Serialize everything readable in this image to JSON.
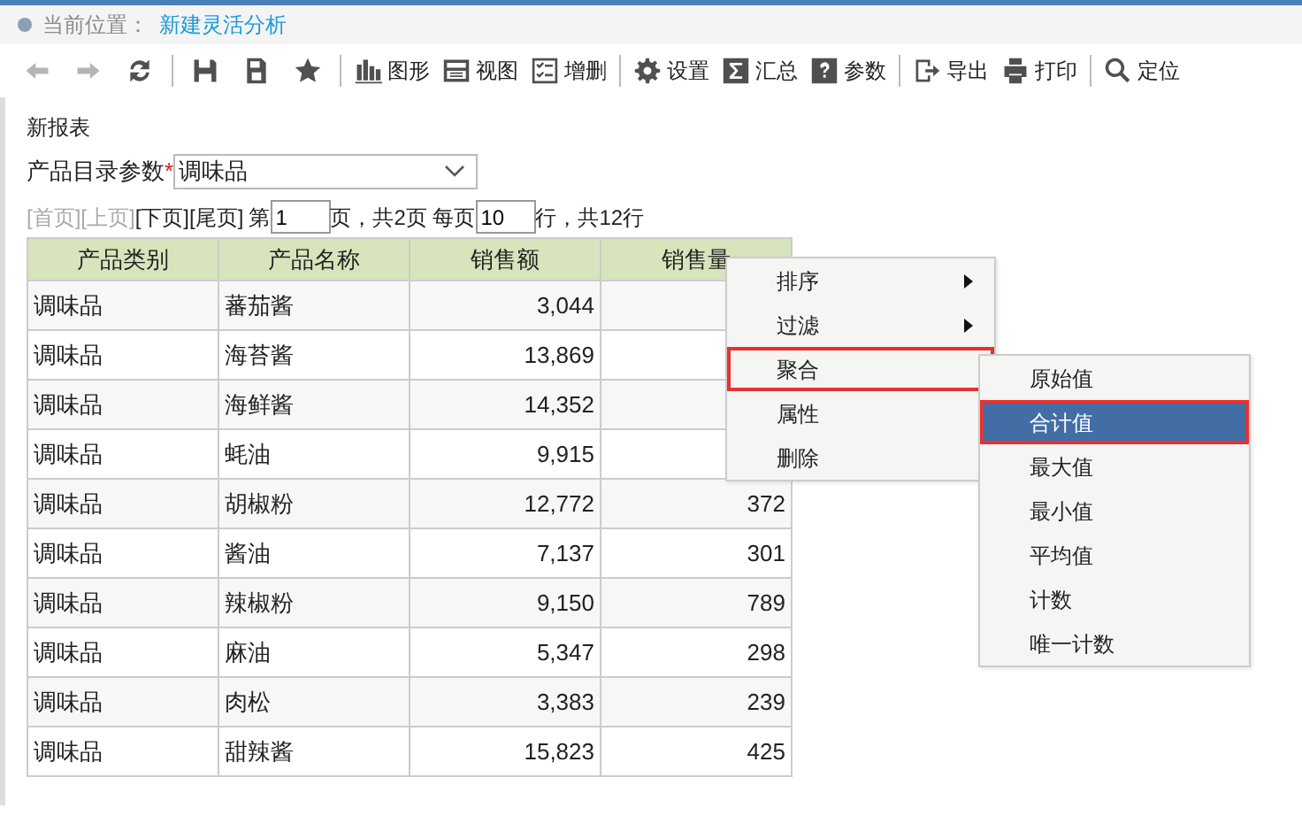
{
  "breadcrumb": {
    "label": "当前位置：",
    "current": "新建灵活分析"
  },
  "toolbar": [
    {
      "kind": "icon",
      "disabled": true
    },
    {
      "kind": "icon",
      "disabled": true
    },
    {
      "kind": "icon",
      "disabled": false
    },
    {
      "kind": "separator"
    },
    {
      "kind": "icon",
      "disabled": false
    },
    {
      "kind": "icon",
      "disabled": false
    },
    {
      "kind": "icon",
      "disabled": false
    },
    {
      "kind": "separator"
    },
    {
      "kind": "button",
      "label": "图形"
    },
    {
      "kind": "button",
      "label": "视图"
    },
    {
      "kind": "button",
      "label": "增删"
    },
    {
      "kind": "separator"
    },
    {
      "kind": "button",
      "label": "设置"
    },
    {
      "kind": "button",
      "label": "汇总"
    },
    {
      "kind": "button",
      "label": "参数"
    },
    {
      "kind": "separator"
    },
    {
      "kind": "button",
      "label": "导出"
    },
    {
      "kind": "button",
      "label": "打印"
    },
    {
      "kind": "separator"
    },
    {
      "kind": "button",
      "label": "定位"
    }
  ],
  "report_title": "新报表",
  "parameter": {
    "label": "产品目录参数",
    "required_mark": "*",
    "value": "调味品"
  },
  "pager": {
    "links": [
      {
        "label": "[首页]",
        "disabled": true
      },
      {
        "label": "[上页]",
        "disabled": true
      },
      {
        "label": "[下页]",
        "disabled": false
      },
      {
        "label": "[尾页]",
        "disabled": false
      }
    ],
    "page_prefix": "第",
    "page": "1",
    "page_suffix": "页，共2页 每页",
    "per_page": "10",
    "rows_suffix": "行，共12行"
  },
  "table": {
    "columns": [
      "产品类别",
      "产品名称",
      "销售额",
      "销售量"
    ],
    "rows": [
      [
        "调味品",
        "蕃茄酱",
        "3,044",
        null
      ],
      [
        "调味品",
        "海苔酱",
        "13,869",
        null
      ],
      [
        "调味品",
        "海鲜酱",
        "14,352",
        null
      ],
      [
        "调味品",
        "蚝油",
        "9,915",
        null
      ],
      [
        "调味品",
        "胡椒粉",
        "12,772",
        "372"
      ],
      [
        "调味品",
        "酱油",
        "7,137",
        "301"
      ],
      [
        "调味品",
        "辣椒粉",
        "9,150",
        "789"
      ],
      [
        "调味品",
        "麻油",
        "5,347",
        "298"
      ],
      [
        "调味品",
        "肉松",
        "3,383",
        "239"
      ],
      [
        "调味品",
        "甜辣酱",
        "15,823",
        "425"
      ]
    ]
  },
  "context_menu": [
    {
      "label": "排序",
      "submenu": true,
      "highlighted": false
    },
    {
      "label": "过滤",
      "submenu": true,
      "highlighted": false
    },
    {
      "label": "聚合",
      "submenu": false,
      "highlighted": true
    },
    {
      "label": "属性",
      "submenu": false,
      "highlighted": false
    },
    {
      "label": "删除",
      "submenu": false,
      "highlighted": false
    }
  ],
  "submenu": [
    {
      "label": "原始值",
      "selected": false,
      "highlighted": false
    },
    {
      "label": "合计值",
      "selected": true,
      "highlighted": true
    },
    {
      "label": "最大值",
      "selected": false,
      "highlighted": false
    },
    {
      "label": "最小值",
      "selected": false,
      "highlighted": false
    },
    {
      "label": "平均值",
      "selected": false,
      "highlighted": false
    },
    {
      "label": "计数",
      "selected": false,
      "highlighted": false
    },
    {
      "label": "唯一计数",
      "selected": false,
      "highlighted": false
    }
  ]
}
